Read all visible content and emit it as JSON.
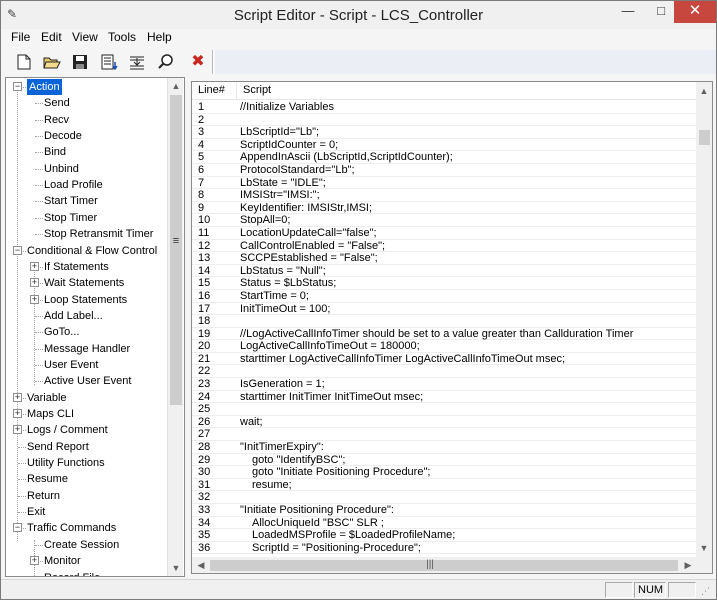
{
  "window": {
    "title": "Script Editor - Script - LCS_Controller"
  },
  "menu": [
    "File",
    "Edit",
    "View",
    "Tools",
    "Help"
  ],
  "toolbar": {
    "icons": [
      "new-file-icon",
      "open-folder-icon",
      "save-icon",
      "compile-icon",
      "step-icon",
      "find-icon",
      "delete-icon"
    ]
  },
  "tree": {
    "items": [
      {
        "label": "Action",
        "level": 0,
        "expander": "minus",
        "selected": true
      },
      {
        "label": "Send",
        "level": 1
      },
      {
        "label": "Recv",
        "level": 1
      },
      {
        "label": "Decode",
        "level": 1
      },
      {
        "label": "Bind",
        "level": 1
      },
      {
        "label": "Unbind",
        "level": 1
      },
      {
        "label": "Load Profile",
        "level": 1
      },
      {
        "label": "Start Timer",
        "level": 1
      },
      {
        "label": "Stop Timer",
        "level": 1
      },
      {
        "label": "Stop Retransmit Timer",
        "level": 1
      },
      {
        "label": "Conditional & Flow Control",
        "level": 0,
        "expander": "minus"
      },
      {
        "label": "If Statements",
        "level": 1,
        "expander": "plus"
      },
      {
        "label": "Wait Statements",
        "level": 1,
        "expander": "plus"
      },
      {
        "label": "Loop Statements",
        "level": 1,
        "expander": "plus"
      },
      {
        "label": "Add Label...",
        "level": 1
      },
      {
        "label": "GoTo...",
        "level": 1
      },
      {
        "label": "Message Handler",
        "level": 1
      },
      {
        "label": "User Event",
        "level": 1
      },
      {
        "label": "Active User Event",
        "level": 1
      },
      {
        "label": "Variable",
        "level": 0,
        "expander": "plus"
      },
      {
        "label": "Maps CLI",
        "level": 0,
        "expander": "plus"
      },
      {
        "label": "Logs / Comment",
        "level": 0,
        "expander": "plus"
      },
      {
        "label": "Send Report",
        "level": 0
      },
      {
        "label": "Utility Functions",
        "level": 0
      },
      {
        "label": "Resume",
        "level": 0
      },
      {
        "label": "Return",
        "level": 0
      },
      {
        "label": "Exit",
        "level": 0
      },
      {
        "label": "Traffic Commands",
        "level": 0,
        "expander": "minus"
      },
      {
        "label": "Create Session",
        "level": 1
      },
      {
        "label": "Monitor",
        "level": 1,
        "expander": "plus"
      },
      {
        "label": "Record File",
        "level": 1
      }
    ]
  },
  "editor": {
    "columns": [
      "Line#",
      "Script"
    ],
    "lines": [
      {
        "n": "1",
        "t": "//Initialize Variables",
        "i": 0
      },
      {
        "n": "2",
        "t": "",
        "i": 0
      },
      {
        "n": "3",
        "t": "LbScriptId=\"Lb\";",
        "i": 0
      },
      {
        "n": "4",
        "t": "ScriptIdCounter = 0;",
        "i": 0
      },
      {
        "n": "5",
        "t": "AppendInAscii (LbScriptId,ScriptIdCounter);",
        "i": 0
      },
      {
        "n": "6",
        "t": "ProtocolStandard=\"Lb\";",
        "i": 0
      },
      {
        "n": "7",
        "t": "LbState = \"IDLE\";",
        "i": 0
      },
      {
        "n": "8",
        "t": "IMSIStr=\"IMSI:\";",
        "i": 0
      },
      {
        "n": "9",
        "t": "KeyIdentifier: IMSIStr,IMSI;",
        "i": 0
      },
      {
        "n": "10",
        "t": "StopAll=0;",
        "i": 0
      },
      {
        "n": "11",
        "t": "LocationUpdateCall=\"false\";",
        "i": 0
      },
      {
        "n": "12",
        "t": "CallControlEnabled = \"False\";",
        "i": 0
      },
      {
        "n": "13",
        "t": "SCCPEstablished = \"False\";",
        "i": 0
      },
      {
        "n": "14",
        "t": "LbStatus = \"Null\";",
        "i": 0
      },
      {
        "n": "15",
        "t": "Status = $LbStatus;",
        "i": 0
      },
      {
        "n": "16",
        "t": "StartTime = 0;",
        "i": 0
      },
      {
        "n": "17",
        "t": "InitTimeOut = 100;",
        "i": 0
      },
      {
        "n": "18",
        "t": "",
        "i": 0
      },
      {
        "n": "19",
        "t": "//LogActiveCallInfoTimer should be set to a value greater than Callduration Timer",
        "i": 0
      },
      {
        "n": "20",
        "t": "LogActiveCallInfoTimeOut = 180000;",
        "i": 0
      },
      {
        "n": "21",
        "t": "starttimer LogActiveCallInfoTimer LogActiveCallInfoTimeOut msec;",
        "i": 0
      },
      {
        "n": "22",
        "t": "",
        "i": 0
      },
      {
        "n": "23",
        "t": "IsGeneration = 1;",
        "i": 0
      },
      {
        "n": "24",
        "t": "starttimer InitTimer InitTimeOut msec;",
        "i": 0
      },
      {
        "n": "25",
        "t": "",
        "i": 0
      },
      {
        "n": "26",
        "t": "wait;",
        "i": 0
      },
      {
        "n": "27",
        "t": "",
        "i": 0
      },
      {
        "n": "28",
        "t": "\"InitTimerExpiry\":",
        "i": 0
      },
      {
        "n": "29",
        "t": "goto \"IdentifyBSC\";",
        "i": 1
      },
      {
        "n": "30",
        "t": "goto \"Initiate Positioning Procedure\";",
        "i": 1
      },
      {
        "n": "31",
        "t": "resume;",
        "i": 1
      },
      {
        "n": "32",
        "t": "",
        "i": 0
      },
      {
        "n": "33",
        "t": "\"Initiate Positioning Procedure\":",
        "i": 0
      },
      {
        "n": "34",
        "t": "AllocUniqueId \"BSC\" SLR ;",
        "i": 1
      },
      {
        "n": "35",
        "t": "LoadedMSProfile = $LoadedProfileName;",
        "i": 1
      },
      {
        "n": "36",
        "t": "ScriptId = \"Positioning-Procedure\";",
        "i": 1
      }
    ]
  },
  "status": {
    "panes": [
      "",
      "NUM",
      ""
    ]
  }
}
